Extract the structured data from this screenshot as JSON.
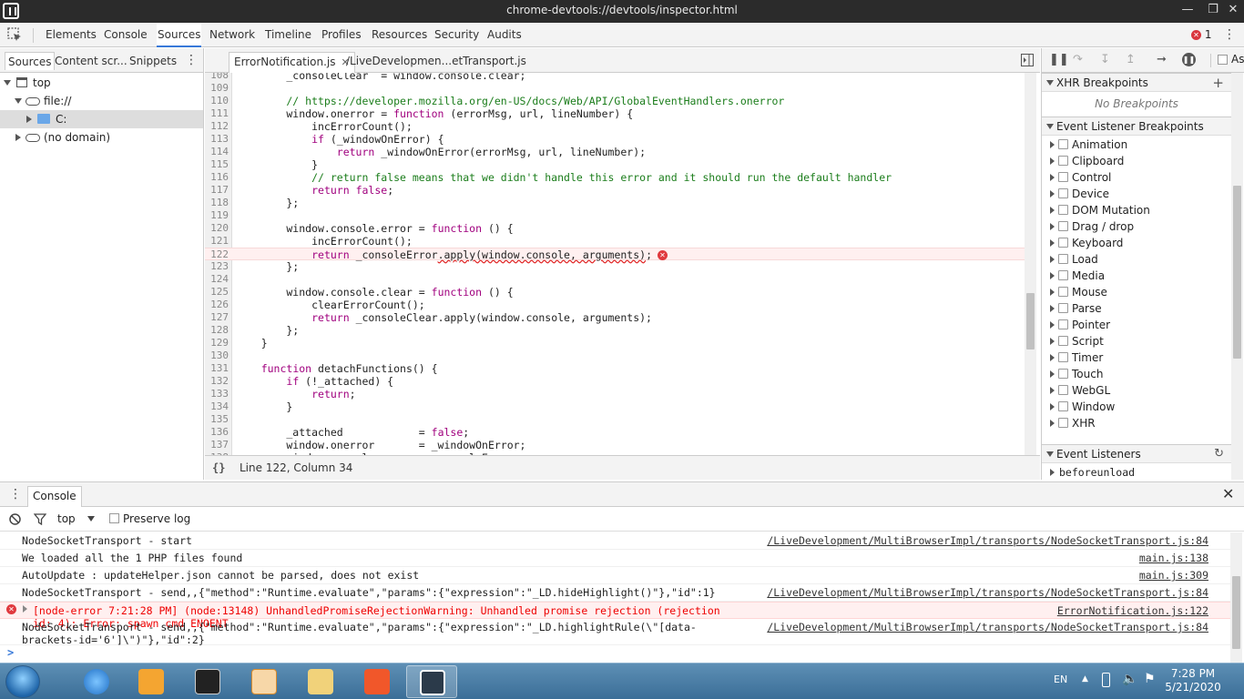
{
  "window": {
    "title": "chrome-devtools://devtools/inspector.html"
  },
  "main_tabs": [
    "Elements",
    "Console",
    "Sources",
    "Network",
    "Timeline",
    "Profiles",
    "Resources",
    "Security",
    "Audits"
  ],
  "error_count": "1",
  "navigator": {
    "tabs": [
      "Sources",
      "Content scr...",
      "Snippets"
    ],
    "tree": {
      "top": "top",
      "file": "file://",
      "drive": "C:",
      "no_domain": "(no domain)"
    }
  },
  "editor": {
    "tabs": [
      "ErrorNotification.js",
      "/LiveDevelopmen...etTransport.js"
    ],
    "status": {
      "pretty": "{}",
      "position": "Line 122, Column 34"
    },
    "lines": [
      {
        "n": "108",
        "t": "        _consoleClear  = window.console.clear;"
      },
      {
        "n": "109",
        "t": ""
      },
      {
        "n": "110",
        "t": "        // https://developer.mozilla.org/en-US/docs/Web/API/GlobalEventHandlers.onerror",
        "c": true
      },
      {
        "n": "111",
        "t": "        window.onerror = function (errorMsg, url, lineNumber) {"
      },
      {
        "n": "112",
        "t": "            incErrorCount();"
      },
      {
        "n": "113",
        "t": "            if (_windowOnError) {"
      },
      {
        "n": "114",
        "t": "                return _windowOnError(errorMsg, url, lineNumber);"
      },
      {
        "n": "115",
        "t": "            }"
      },
      {
        "n": "116",
        "t": "            // return false means that we didn't handle this error and it should run the default handler",
        "c": true
      },
      {
        "n": "117",
        "t": "            return false;"
      },
      {
        "n": "118",
        "t": "        };"
      },
      {
        "n": "119",
        "t": ""
      },
      {
        "n": "120",
        "t": "        window.console.error = function () {"
      },
      {
        "n": "121",
        "t": "            incErrorCount();"
      },
      {
        "n": "122",
        "t": "            return _consoleError.apply(window.console, arguments);",
        "err": true
      },
      {
        "n": "123",
        "t": "        };"
      },
      {
        "n": "124",
        "t": ""
      },
      {
        "n": "125",
        "t": "        window.console.clear = function () {"
      },
      {
        "n": "126",
        "t": "            clearErrorCount();"
      },
      {
        "n": "127",
        "t": "            return _consoleClear.apply(window.console, arguments);"
      },
      {
        "n": "128",
        "t": "        };"
      },
      {
        "n": "129",
        "t": "    }"
      },
      {
        "n": "130",
        "t": ""
      },
      {
        "n": "131",
        "t": "    function detachFunctions() {"
      },
      {
        "n": "132",
        "t": "        if (!_attached) {"
      },
      {
        "n": "133",
        "t": "            return;"
      },
      {
        "n": "134",
        "t": "        }"
      },
      {
        "n": "135",
        "t": ""
      },
      {
        "n": "136",
        "t": "        _attached            = false;"
      },
      {
        "n": "137",
        "t": "        window.onerror       = _windowOnError;"
      },
      {
        "n": "138",
        "t": "        window.console.error = _consoleError;"
      }
    ]
  },
  "debugger": {
    "xhr_header": "XHR Breakpoints",
    "xhr_empty": "No Breakpoints",
    "event_header": "Event Listener Breakpoints",
    "events": [
      "Animation",
      "Clipboard",
      "Control",
      "Device",
      "DOM Mutation",
      "Drag / drop",
      "Keyboard",
      "Load",
      "Media",
      "Mouse",
      "Parse",
      "Pointer",
      "Script",
      "Timer",
      "Touch",
      "WebGL",
      "Window",
      "XHR"
    ],
    "listeners_header": "Event Listeners",
    "listeners": [
      "beforeunload"
    ],
    "async_label": "As"
  },
  "drawer": {
    "tab": "Console",
    "context": "top",
    "preserve_log": "Preserve log",
    "prompt": ">",
    "messages": [
      {
        "text": "NodeSocketTransport - start",
        "src": "/LiveDevelopment/MultiBrowserImpl/transports/NodeSocketTransport.js:84"
      },
      {
        "text": "We loaded all the 1 PHP files found",
        "src": "main.js:138"
      },
      {
        "text": "AutoUpdate : updateHelper.json cannot be parsed, does not exist",
        "src": "main.js:309"
      },
      {
        "text": "NodeSocketTransport - send,,{\"method\":\"Runtime.evaluate\",\"params\":{\"expression\":\"_LD.hideHighlight()\"},\"id\":1}",
        "src": "/LiveDevelopment/MultiBrowserImpl/transports/NodeSocketTransport.js:84"
      },
      {
        "text": "[node-error 7:21:28 PM] (node:13148) UnhandledPromiseRejectionWarning: Unhandled promise rejection (rejection id: 4): Error: spawn cmd ENOENT",
        "src": "ErrorNotification.js:122",
        "error": true
      },
      {
        "text": "NodeSocketTransport - send,,{\"method\":\"Runtime.evaluate\",\"params\":{\"expression\":\"_LD.highlightRule(\\\"[data-brackets-id='6']\\\")\"},\"id\":2}",
        "src": "/LiveDevelopment/MultiBrowserImpl/transports/NodeSocketTransport.js:84"
      }
    ]
  },
  "taskbar": {
    "lang": "EN",
    "time": "7:28 PM",
    "date": "5/21/2020"
  }
}
